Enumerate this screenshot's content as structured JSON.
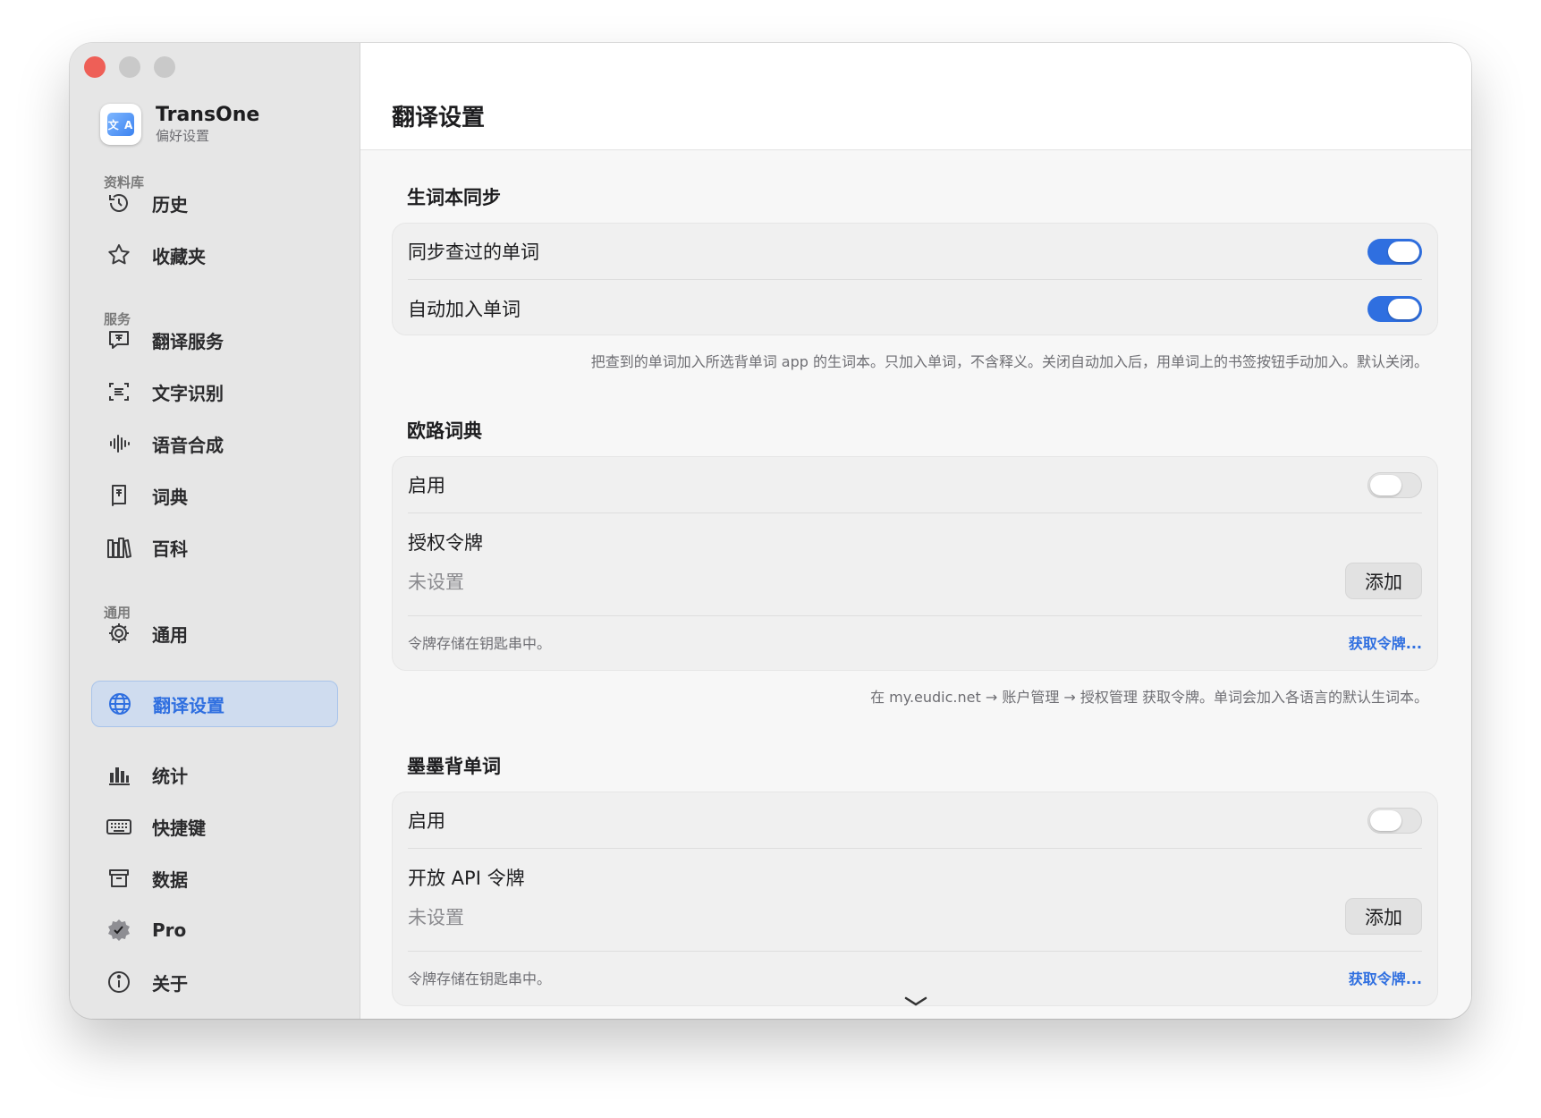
{
  "app": {
    "name": "TransOne",
    "subtitle": "偏好设置",
    "icon_text": "文 A"
  },
  "sidebar": {
    "sections": [
      {
        "label": "资料库"
      },
      {
        "label": "服务"
      },
      {
        "label": "通用"
      }
    ],
    "items": [
      {
        "label": "历史",
        "icon": "history-icon"
      },
      {
        "label": "收藏夹",
        "icon": "star-icon"
      },
      {
        "label": "翻译服务",
        "icon": "translate-service-icon"
      },
      {
        "label": "文字识别",
        "icon": "text-recognition-icon"
      },
      {
        "label": "语音合成",
        "icon": "waveform-icon"
      },
      {
        "label": "词典",
        "icon": "dictionary-icon"
      },
      {
        "label": "百科",
        "icon": "books-icon"
      },
      {
        "label": "通用",
        "icon": "gear-icon"
      },
      {
        "label": "翻译设置",
        "icon": "globe-icon",
        "active": true
      },
      {
        "label": "统计",
        "icon": "bar-chart-icon"
      },
      {
        "label": "快捷键",
        "icon": "keyboard-icon"
      },
      {
        "label": "数据",
        "icon": "archive-box-icon"
      },
      {
        "label": "Pro",
        "icon": "verified-badge-icon"
      },
      {
        "label": "关于",
        "icon": "info-icon"
      }
    ]
  },
  "main": {
    "title": "翻译设置",
    "vocab_sync": {
      "title": "生词本同步",
      "rows": [
        {
          "label": "同步查过的单词",
          "enabled": true
        },
        {
          "label": "自动加入单词",
          "enabled": true
        }
      ],
      "note": "把查到的单词加入所选背单词 app 的生词本。只加入单词，不含释义。关闭自动加入后，用单词上的书签按钮手动加入。默认关闭。"
    },
    "eudic": {
      "title": "欧路词典",
      "enable_label": "启用",
      "enabled": false,
      "token_label": "授权令牌",
      "token_value": "未设置",
      "add_button": "添加",
      "storage_note": "令牌存储在钥匙串中。",
      "get_token_link": "获取令牌...",
      "note": "在 my.eudic.net → 账户管理 → 授权管理 获取令牌。单词会加入各语言的默认生词本。"
    },
    "momo": {
      "title": "墨墨背单词",
      "enable_label": "启用",
      "enabled": false,
      "token_label": "开放 API 令牌",
      "token_value": "未设置",
      "add_button": "添加",
      "storage_note": "令牌存储在钥匙串中。",
      "get_token_link": "获取令牌..."
    }
  },
  "colors": {
    "accent": "#2f6fe0",
    "close": "#ee5f57",
    "sidebar_bg": "#e6e6e6"
  }
}
